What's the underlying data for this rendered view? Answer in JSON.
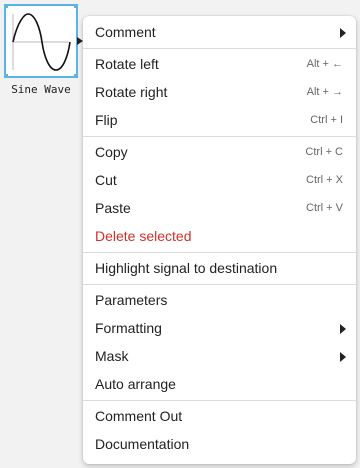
{
  "block": {
    "name": "Sine Wave",
    "icon": "sine-wave-icon"
  },
  "menu": {
    "groups": [
      {
        "items": [
          {
            "label": "Comment",
            "submenu": true
          }
        ]
      },
      {
        "items": [
          {
            "label": "Rotate left",
            "shortcut": "Alt + ←"
          },
          {
            "label": "Rotate right",
            "shortcut": "Alt + →"
          },
          {
            "label": "Flip",
            "shortcut": "Ctrl + I"
          }
        ]
      },
      {
        "items": [
          {
            "label": "Copy",
            "shortcut": "Ctrl + C"
          },
          {
            "label": "Cut",
            "shortcut": "Ctrl + X"
          },
          {
            "label": "Paste",
            "shortcut": "Ctrl + V"
          },
          {
            "label": "Delete selected",
            "danger": true
          }
        ]
      },
      {
        "items": [
          {
            "label": "Highlight signal to destination"
          }
        ]
      },
      {
        "items": [
          {
            "label": "Parameters"
          },
          {
            "label": "Formatting",
            "submenu": true
          },
          {
            "label": "Mask",
            "submenu": true
          },
          {
            "label": "Auto arrange"
          }
        ]
      },
      {
        "items": [
          {
            "label": "Comment Out"
          },
          {
            "label": "Documentation"
          }
        ]
      }
    ]
  },
  "colors": {
    "selection": "#5ab4e6",
    "danger": "#d0302b"
  }
}
